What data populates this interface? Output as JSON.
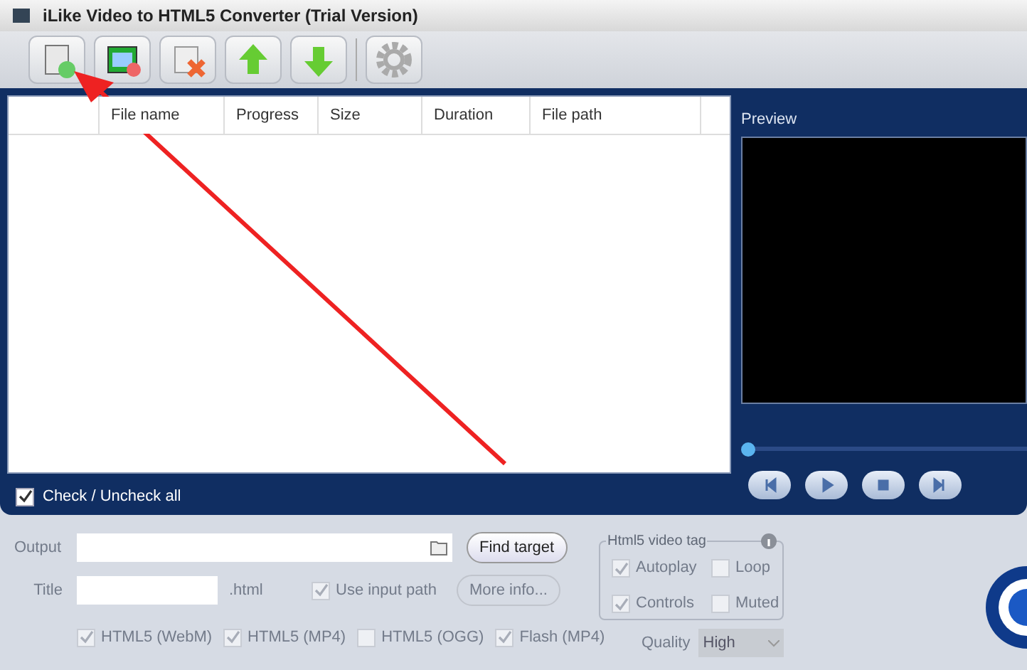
{
  "window": {
    "title": "iLike Video to HTML5 Converter (Trial Version)"
  },
  "toolbar": [
    {
      "kind": "add"
    },
    {
      "kind": "film"
    },
    {
      "kind": "remove"
    },
    {
      "kind": "up"
    },
    {
      "kind": "down"
    },
    {
      "kind": "settings"
    }
  ],
  "table": {
    "columns": [
      "File name",
      "Progress",
      "Size",
      "Duration",
      "File path"
    ]
  },
  "check_all": {
    "label": "Check / Uncheck all",
    "checked": true
  },
  "preview": {
    "title": "Preview",
    "level": 0
  },
  "output": {
    "label": "Output",
    "find_button": "Find target"
  },
  "title_field": {
    "label": "Title",
    "suffix": ".html",
    "use_input_path": {
      "label": "Use input path",
      "checked": true
    },
    "more_button": "More info..."
  },
  "video_tag": {
    "title": "Html5 video tag",
    "options": [
      {
        "label": "Autoplay",
        "checked": true
      },
      {
        "label": "Loop",
        "checked": false
      },
      {
        "label": "Controls",
        "checked": true
      },
      {
        "label": "Muted",
        "checked": false
      }
    ]
  },
  "formats": [
    {
      "label": "HTML5 (WebM)",
      "checked": true
    },
    {
      "label": "HTML5 (MP4)",
      "checked": true
    },
    {
      "label": "HTML5 (OGG)",
      "checked": false
    },
    {
      "label": "Flash (MP4)",
      "checked": true
    }
  ],
  "quality": {
    "label": "Quality",
    "value": "High"
  }
}
